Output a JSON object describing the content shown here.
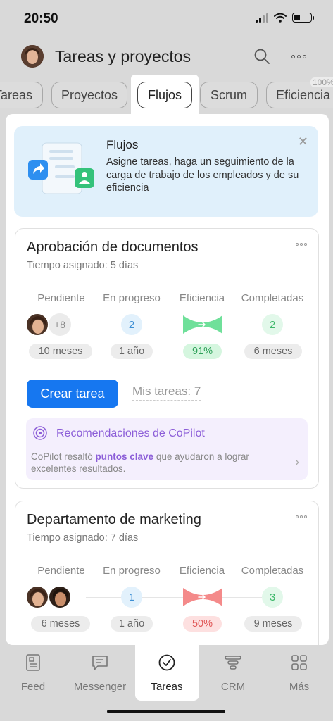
{
  "status": {
    "time": "20:50"
  },
  "header": {
    "title": "Tareas y proyectos"
  },
  "tabs": [
    {
      "label": "Tareas"
    },
    {
      "label": "Proyectos"
    },
    {
      "label": "Flujos"
    },
    {
      "label": "Scrum"
    },
    {
      "label": "Eficiencia",
      "badge": "100%"
    }
  ],
  "banner": {
    "title": "Flujos",
    "text": "Asigne tareas, haga un seguimiento de la carga de trabajo de los empleados y de su eficiencia",
    "close_icon": "close-icon"
  },
  "stat_headers": {
    "pending": "Pendiente",
    "in_progress": "En progreso",
    "efficiency": "Eficiencia",
    "completed": "Completadas"
  },
  "cards": [
    {
      "title": "Aprobación de documentos",
      "subtitle": "Tiempo asignado: 5 días",
      "pending_extra": "+8",
      "pending_time": "10 meses",
      "in_progress_count": "2",
      "in_progress_time": "1 año",
      "efficiency": "91%",
      "completed_count": "2",
      "completed_time": "6 meses",
      "create_button": "Crear tarea",
      "my_tasks": "Mis tareas: 7",
      "copilot": {
        "title": "Recomendaciones de CoPilot",
        "text_before": "CoPilot resaltó ",
        "text_highlight": "puntos clave",
        "text_after": " que ayudaron a lograr excelentes resultados."
      }
    },
    {
      "title": "Departamento de marketing",
      "subtitle": "Tiempo asignado: 7 días",
      "pending_time": "6 meses",
      "in_progress_count": "1",
      "in_progress_time": "1 año",
      "efficiency": "50%",
      "completed_count": "3",
      "completed_time": "9 meses"
    }
  ],
  "bottom_nav": [
    {
      "label": "Feed",
      "icon": "feed-icon"
    },
    {
      "label": "Messenger",
      "icon": "messenger-icon"
    },
    {
      "label": "Tareas",
      "icon": "tasks-check-icon"
    },
    {
      "label": "CRM",
      "icon": "crm-icon"
    },
    {
      "label": "Más",
      "icon": "grid-icon"
    }
  ],
  "colors": {
    "accent": "#1677f0",
    "success": "#3db86a",
    "danger": "#f07575",
    "copilot": "#8c5ed8"
  }
}
